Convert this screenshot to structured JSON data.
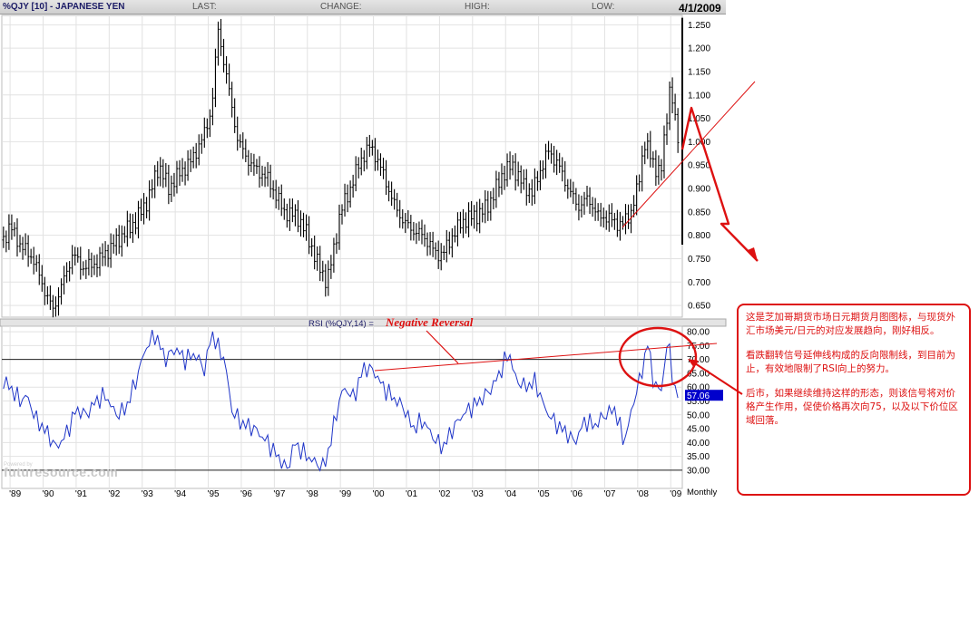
{
  "header": {
    "symbol": "%QJY [10] - JAPANESE YEN",
    "last_label": "LAST:",
    "change_label": "CHANGE:",
    "high_label": "HIGH:",
    "low_label": "LOW:",
    "date": "4/1/2009"
  },
  "rsi_panel": {
    "label": "RSI (%QJY,14) =",
    "annotation": "Negative Reversal",
    "current_value": "57.06"
  },
  "footer": {
    "powered_by": "Powered by",
    "logo_text": "futuresource.com",
    "period_label": "Monthly"
  },
  "annotations": {
    "note1": "这是芝加哥期货市场日元期货月图图标，与现货外汇市场美元/日元的对应发展趋向，刚好相反。",
    "note2": "看跌翻转信号延伸线构成的反向限制线，到目前为止，有效地限制了RSI向上的努力。",
    "note3": "后市，如果继续维持这样的形态，则该信号将对价格产生作用，促使价格再次向75，以及以下价位区域回落。"
  },
  "colors": {
    "price": "#000000",
    "rsi": "#1f35c8",
    "annotation": "#dd1111",
    "header_text": "#1b1b66",
    "value_box": "#0000cc"
  },
  "chart_data": [
    {
      "type": "bar",
      "title": "%QJY [10] - JAPANESE YEN",
      "x_ticks": [
        "'89",
        "'90",
        "'91",
        "'92",
        "'93",
        "'94",
        "'95",
        "'96",
        "'97",
        "'98",
        "'99",
        "'00",
        "'01",
        "'02",
        "'03",
        "'04",
        "'05",
        "'06",
        "'07",
        "'08",
        "'09"
      ],
      "y_ticks": [
        "1.250",
        "1.200",
        "1.150",
        "1.100",
        "1.050",
        "1.000",
        "0.950",
        "0.900",
        "0.850",
        "0.800",
        "0.750",
        "0.700",
        "0.650"
      ],
      "ylim": [
        0.625,
        1.27
      ],
      "xlim": [
        1988.75,
        2009.35
      ],
      "grid": true,
      "series": [
        {
          "x": [
            1988.8,
            1989.0,
            1989.3,
            1989.7,
            1990.0,
            1990.3,
            1990.6,
            1990.9,
            1991.2,
            1991.6,
            1992.0,
            1992.4,
            1992.8,
            1993.2,
            1993.5,
            1993.8,
            1994.1,
            1994.5,
            1994.9,
            1995.1,
            1995.3,
            1995.6,
            1995.9,
            1996.3,
            1996.8,
            1997.3,
            1997.7,
            1998.0,
            1998.3,
            1998.6,
            1998.8,
            1999.0,
            1999.3,
            1999.6,
            1999.9,
            2000.0,
            2000.3,
            2000.6,
            2000.9,
            2001.2,
            2001.5,
            2001.9,
            2002.1,
            2002.4,
            2002.7,
            2003.0,
            2003.3,
            2003.6,
            2003.9,
            2004.2,
            2004.5,
            2004.8,
            2005.0,
            2005.3,
            2005.6,
            2005.9,
            2006.2,
            2006.5,
            2006.8,
            2007.0,
            2007.3,
            2007.5,
            2007.8,
            2008.0,
            2008.2,
            2008.5,
            2008.7,
            2008.9,
            2009.0,
            2009.1,
            2009.25
          ],
          "values": [
            0.79,
            0.82,
            0.78,
            0.75,
            0.69,
            0.64,
            0.7,
            0.76,
            0.73,
            0.74,
            0.77,
            0.8,
            0.83,
            0.88,
            0.95,
            0.9,
            0.93,
            0.96,
            1.02,
            1.07,
            1.24,
            1.12,
            1.0,
            0.95,
            0.92,
            0.85,
            0.84,
            0.8,
            0.74,
            0.7,
            0.77,
            0.85,
            0.9,
            0.96,
            0.99,
            0.98,
            0.93,
            0.87,
            0.83,
            0.81,
            0.8,
            0.76,
            0.76,
            0.8,
            0.83,
            0.84,
            0.85,
            0.88,
            0.93,
            0.95,
            0.91,
            0.89,
            0.93,
            0.98,
            0.95,
            0.9,
            0.86,
            0.88,
            0.84,
            0.84,
            0.83,
            0.82,
            0.85,
            0.9,
            1.0,
            0.95,
            0.93,
            1.07,
            1.13,
            1.05,
            1.0
          ]
        }
      ]
    },
    {
      "type": "line",
      "title": "RSI (%QJY,14)",
      "y_ticks": [
        "80.00",
        "75.00",
        "70.00",
        "65.00",
        "60.00",
        "55.00",
        "50.00",
        "45.00",
        "40.00",
        "35.00",
        "30.00"
      ],
      "ylim": [
        28,
        82
      ],
      "reference_lines": [
        70,
        30
      ],
      "current_value": 57.06,
      "series": [
        {
          "x": [
            1988.8,
            1989.0,
            1989.3,
            1989.5,
            1989.8,
            1990.1,
            1990.4,
            1990.7,
            1991.0,
            1991.3,
            1991.6,
            1991.9,
            1992.2,
            1992.5,
            1992.8,
            1993.1,
            1993.4,
            1993.7,
            1994.0,
            1994.3,
            1994.6,
            1994.9,
            1995.1,
            1995.3,
            1995.5,
            1995.7,
            1996.0,
            1996.4,
            1996.8,
            1997.1,
            1997.4,
            1997.6,
            1997.9,
            1998.2,
            1998.5,
            1998.7,
            1998.9,
            1999.1,
            1999.4,
            1999.7,
            2000.0,
            2000.3,
            2000.6,
            2000.9,
            2001.2,
            2001.5,
            2001.8,
            2002.1,
            2002.4,
            2002.7,
            2003.0,
            2003.3,
            2003.6,
            2003.9,
            2004.1,
            2004.3,
            2004.6,
            2004.9,
            2005.2,
            2005.5,
            2005.8,
            2006.1,
            2006.4,
            2006.7,
            2007.0,
            2007.3,
            2007.6,
            2007.9,
            2008.1,
            2008.3,
            2008.5,
            2008.7,
            2008.9,
            2009.0,
            2009.1,
            2009.25
          ],
          "values": [
            62,
            60,
            55,
            57,
            48,
            44,
            38,
            43,
            52,
            50,
            55,
            57,
            50,
            52,
            62,
            74,
            79,
            70,
            74,
            70,
            72,
            66,
            80,
            74,
            70,
            52,
            47,
            45,
            40,
            35,
            30,
            40,
            36,
            33,
            31,
            40,
            52,
            60,
            56,
            67,
            66,
            60,
            56,
            53,
            45,
            48,
            42,
            38,
            45,
            50,
            53,
            56,
            60,
            67,
            73,
            63,
            60,
            62,
            52,
            47,
            44,
            40,
            48,
            46,
            50,
            52,
            40,
            56,
            64,
            76,
            61,
            58,
            76,
            72,
            58,
            57
          ]
        }
      ]
    }
  ]
}
